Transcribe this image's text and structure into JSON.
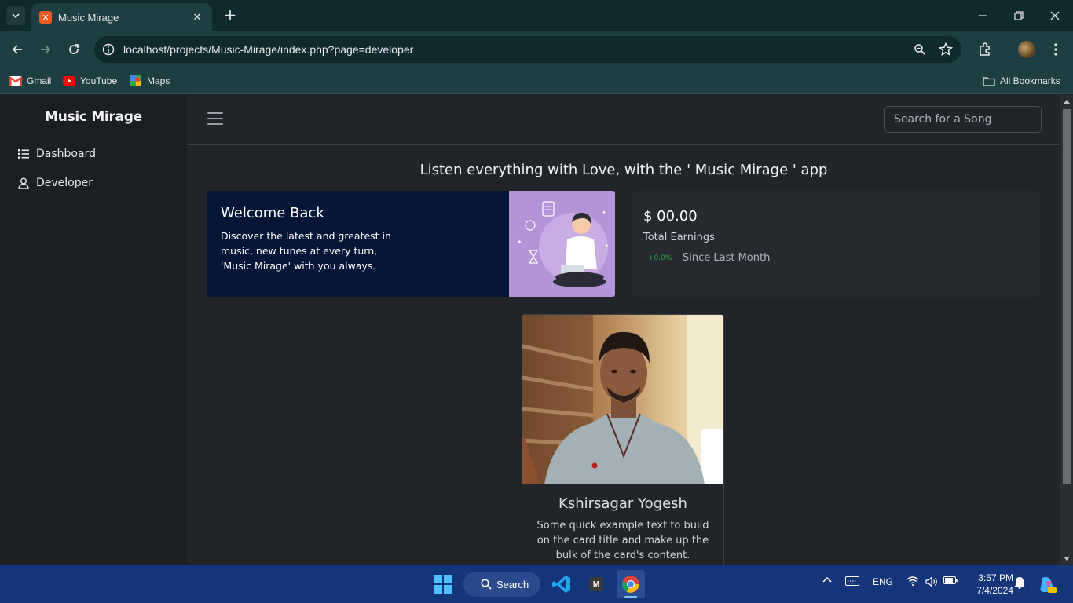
{
  "browser": {
    "tab_title": "Music Mirage",
    "url": "localhost/projects/Music-Mirage/index.php?page=developer",
    "bookmarks": [
      "Gmail",
      "YouTube",
      "Maps"
    ],
    "all_bookmarks": "All Bookmarks"
  },
  "sidebar": {
    "brand": "Music Mirage",
    "items": [
      {
        "label": "Dashboard",
        "icon": "list-icon"
      },
      {
        "label": "Developer",
        "icon": "user-icon"
      }
    ]
  },
  "topbar": {
    "search_placeholder": "Search for a Song"
  },
  "main": {
    "tagline": "Listen everything with Love, with the ' Music Mirage ' app",
    "welcome": {
      "title": "Welcome Back",
      "text": "Discover the latest and greatest in music, new tunes at every turn, 'Music Mirage' with you always."
    },
    "earnings": {
      "amount": "$ 00.00",
      "label": "Total Earnings",
      "change": "+0.0%",
      "since": "Since Last Month"
    },
    "developer_card": {
      "name": "Kshirsagar Yogesh",
      "text": "Some quick example text to build on the card title and make up the bulk of the card's content."
    }
  },
  "taskbar": {
    "search_label": "Search",
    "language": "ENG",
    "time": "3:57 PM",
    "date": "7/4/2024"
  },
  "colors": {
    "chrome_bg": "#1d3f43",
    "page_bg": "#212529",
    "sidebar_bg": "#1b1e22",
    "welcome_bg": "#041538",
    "positive": "#28a745",
    "taskbar_bg": "#14357a"
  }
}
